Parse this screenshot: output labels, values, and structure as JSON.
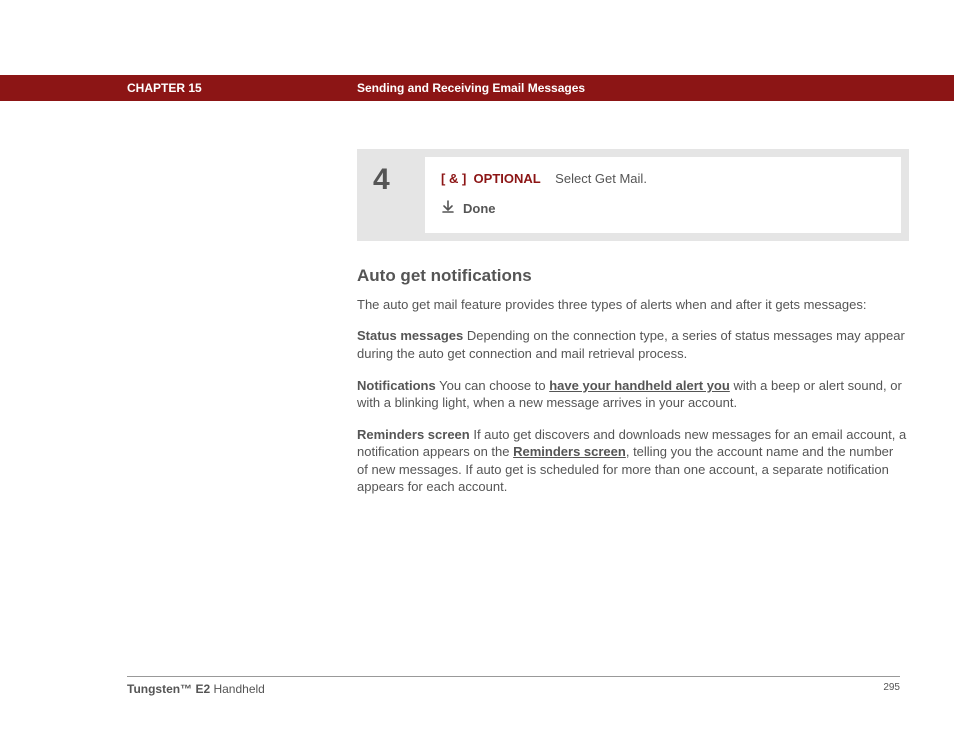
{
  "header": {
    "chapter": "CHAPTER 15",
    "title": "Sending and Receiving Email Messages"
  },
  "step": {
    "number": "4",
    "bracket": "[ & ]",
    "optional": "OPTIONAL",
    "instruction": "Select Get Mail.",
    "done": "Done"
  },
  "section": {
    "heading": "Auto get notifications",
    "intro": "The auto get mail feature provides three types of alerts when and after it gets messages:",
    "status_label": "Status messages",
    "status_text": "   Depending on the connection type, a series of status messages may appear during the auto get connection and mail retrieval process.",
    "notif_label": "Notifications",
    "notif_before": "   You can choose to ",
    "notif_link": "have your handheld alert you",
    "notif_after": " with a beep or alert sound, or with a blinking light, when a new message arrives in your account.",
    "rem_label": "Reminders screen",
    "rem_before": "   If auto get discovers and downloads new messages for an email account, a notification appears on the ",
    "rem_link": "Reminders screen",
    "rem_after": ", telling you the account name and the number of new messages. If auto get is scheduled for more than one account, a separate notification appears for each account."
  },
  "footer": {
    "product_bold": "Tungsten™ E2",
    "product_rest": " Handheld",
    "page": "295"
  }
}
